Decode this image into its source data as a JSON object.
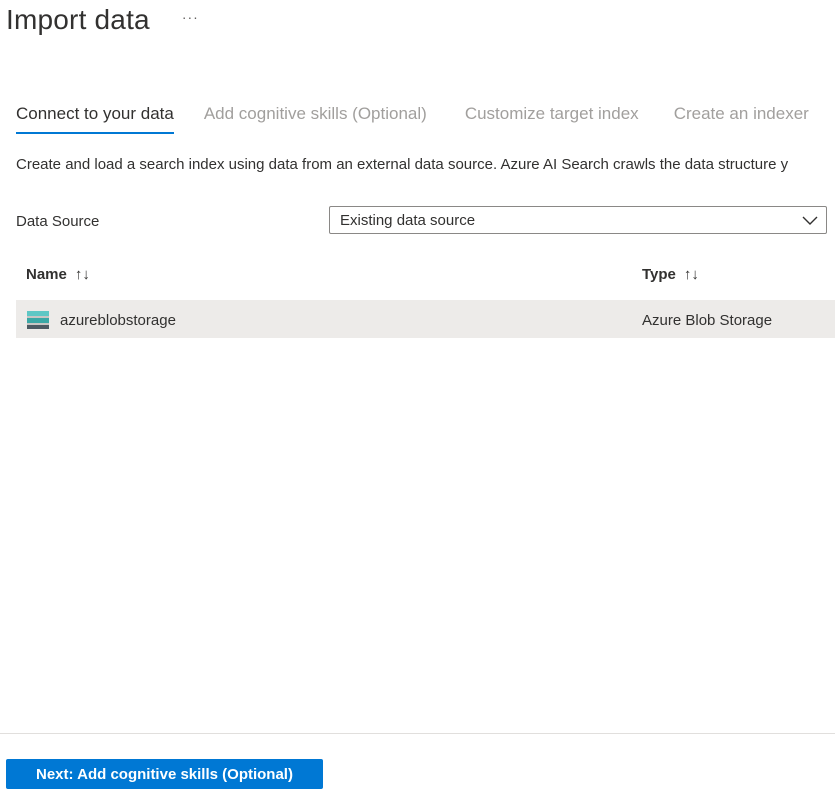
{
  "header": {
    "title": "Import data",
    "more_label": "···"
  },
  "tabs": [
    {
      "label": "Connect to your data",
      "active": true
    },
    {
      "label": "Add cognitive skills (Optional)",
      "active": false
    },
    {
      "label": "Customize target index",
      "active": false
    },
    {
      "label": "Create an indexer",
      "active": false
    }
  ],
  "description": "Create and load a search index using data from an external data source. Azure AI Search crawls the data structure y",
  "data_source": {
    "label": "Data Source",
    "selected": "Existing data source"
  },
  "table": {
    "columns": [
      {
        "label": "Name",
        "sort_icon": "↑↓"
      },
      {
        "label": "Type",
        "sort_icon": "↑↓"
      }
    ],
    "rows": [
      {
        "icon": "storage-account-icon",
        "name": "azureblobstorage",
        "type": "Azure Blob Storage"
      }
    ]
  },
  "footer": {
    "next_label": "Next: Add cognitive skills (Optional)"
  },
  "colors": {
    "accent": "#0078d4",
    "selected_row": "#edebe9",
    "inactive_tab": "#a19f9d"
  }
}
